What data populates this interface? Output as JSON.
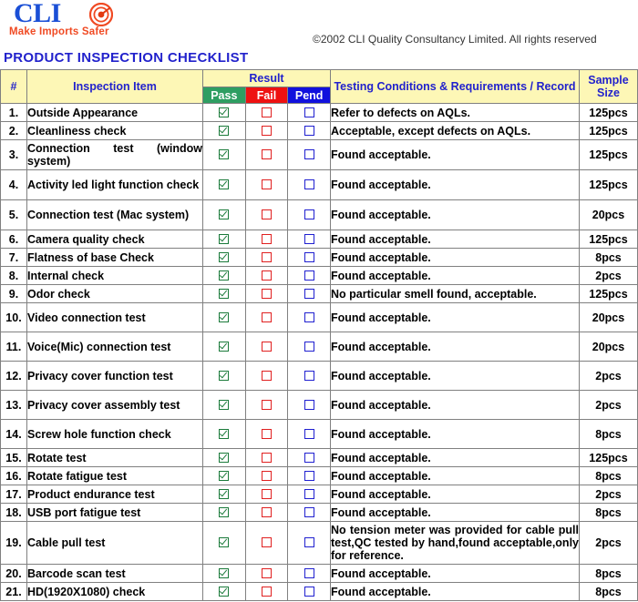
{
  "logo": {
    "wordmark": "CLI",
    "tagline": "Make Imports Safer",
    "icon": "target-spiral-icon",
    "wordmark_color": "#1a4fd6",
    "tagline_color": "#f04a23"
  },
  "copyright": "©2002   CLI Quality Consultancy Limited.  All rights reserved",
  "doc_title": "PRODUCT INSPECTION  CHECKLIST",
  "table": {
    "headers": {
      "num": "#",
      "item": "Inspection Item",
      "result": "Result",
      "pass": "Pass",
      "fail": "Fail",
      "pend": "Pend",
      "test": "Testing Conditions & Requirements / Record",
      "sample": "Sample Size"
    },
    "header_colors": {
      "background": "#fdf7b6",
      "text": "#2222cc",
      "pass": "#2e9e62",
      "fail": "#ee1111",
      "pend": "#1111dd"
    },
    "rows": [
      {
        "num": "1.",
        "item": "Outside Appearance",
        "pass": true,
        "fail": false,
        "pend": false,
        "test": "Refer to defects on AQLs.",
        "sample": "125pcs"
      },
      {
        "num": "2.",
        "item": "Cleanliness check",
        "pass": true,
        "fail": false,
        "pend": false,
        "test": "Acceptable, except defects on AQLs.",
        "sample": "125pcs"
      },
      {
        "num": "3.",
        "item": "Connection test (window system)",
        "pass": true,
        "fail": false,
        "pend": false,
        "test": "Found acceptable.",
        "sample": "125pcs"
      },
      {
        "num": "4.",
        "item": "Activity led light function check",
        "pass": true,
        "fail": false,
        "pend": false,
        "test": "Found acceptable.",
        "sample": "125pcs"
      },
      {
        "num": "5.",
        "item": "Connection test (Mac system)",
        "pass": true,
        "fail": false,
        "pend": false,
        "test": "Found acceptable.",
        "sample": "20pcs"
      },
      {
        "num": "6.",
        "item": "Camera quality check",
        "pass": true,
        "fail": false,
        "pend": false,
        "test": "Found acceptable.",
        "sample": "125pcs"
      },
      {
        "num": "7.",
        "item": "Flatness of base Check",
        "pass": true,
        "fail": false,
        "pend": false,
        "test": "Found acceptable.",
        "sample": "8pcs"
      },
      {
        "num": "8.",
        "item": "Internal check",
        "pass": true,
        "fail": false,
        "pend": false,
        "test": "Found acceptable.",
        "sample": "2pcs"
      },
      {
        "num": "9.",
        "item": "Odor check",
        "pass": true,
        "fail": false,
        "pend": false,
        "test": "No particular smell found, acceptable.",
        "sample": "125pcs"
      },
      {
        "num": "10.",
        "item": "Video connection test",
        "pass": true,
        "fail": false,
        "pend": false,
        "test": "Found acceptable.",
        "sample": "20pcs"
      },
      {
        "num": "11.",
        "item": "Voice(Mic) connection test",
        "pass": true,
        "fail": false,
        "pend": false,
        "test": "Found acceptable.",
        "sample": "20pcs"
      },
      {
        "num": "12.",
        "item": "Privacy cover function test",
        "pass": true,
        "fail": false,
        "pend": false,
        "test": "Found acceptable.",
        "sample": "2pcs"
      },
      {
        "num": "13.",
        "item": "Privacy cover assembly test",
        "pass": true,
        "fail": false,
        "pend": false,
        "test": "Found acceptable.",
        "sample": "2pcs"
      },
      {
        "num": "14.",
        "item": "Screw hole function check",
        "pass": true,
        "fail": false,
        "pend": false,
        "test": "Found acceptable.",
        "sample": "8pcs"
      },
      {
        "num": "15.",
        "item": "Rotate  test",
        "pass": true,
        "fail": false,
        "pend": false,
        "test": "Found acceptable.",
        "sample": "125pcs"
      },
      {
        "num": "16.",
        "item": "Rotate fatigue test",
        "pass": true,
        "fail": false,
        "pend": false,
        "test": "Found acceptable.",
        "sample": "8pcs"
      },
      {
        "num": "17.",
        "item": "Product endurance test",
        "pass": true,
        "fail": false,
        "pend": false,
        "test": "Found acceptable.",
        "sample": "2pcs"
      },
      {
        "num": "18.",
        "item": "USB port fatigue test",
        "pass": true,
        "fail": false,
        "pend": false,
        "test": "Found acceptable.",
        "sample": "8pcs"
      },
      {
        "num": "19.",
        "item": "Cable pull test",
        "pass": true,
        "fail": false,
        "pend": false,
        "test": "No tension meter was provided for cable pull test,QC tested by hand,found acceptable,only for reference.",
        "sample": "2pcs"
      },
      {
        "num": "20.",
        "item": "Barcode scan test",
        "pass": true,
        "fail": false,
        "pend": false,
        "test": "Found acceptable.",
        "sample": "8pcs"
      },
      {
        "num": "21.",
        "item": "HD(1920X1080) check",
        "pass": true,
        "fail": false,
        "pend": false,
        "test": "Found acceptable.",
        "sample": "8pcs"
      }
    ]
  }
}
